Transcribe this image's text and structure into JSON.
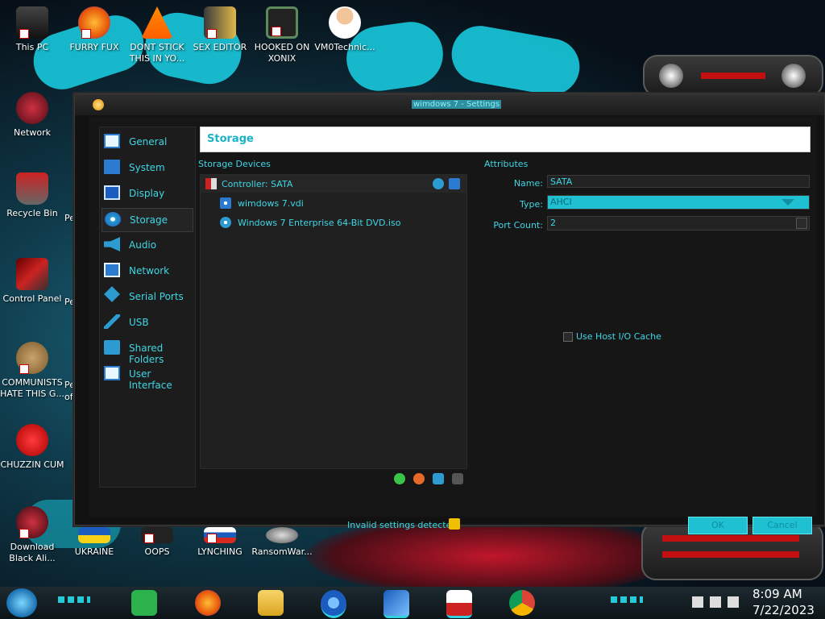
{
  "desktop": {
    "icons": [
      {
        "label": "This PC"
      },
      {
        "label": "FURRY FUX"
      },
      {
        "label": "DONT STICK THIS IN YO..."
      },
      {
        "label": "SEX EDITOR"
      },
      {
        "label": "HOOKED ON XONIX"
      },
      {
        "label": "VM0Technic..."
      },
      {
        "label": "Network"
      },
      {
        "label": "Recycle Bin"
      },
      {
        "label": "Control Panel"
      },
      {
        "label": "COMMUNISTS HATE THIS G..."
      },
      {
        "label": "CHUZZIN CUM"
      },
      {
        "label": "Download Black Ali..."
      },
      {
        "label": "UKRAINE"
      },
      {
        "label": "OOPS"
      },
      {
        "label": "LYNCHING"
      },
      {
        "label": "RansomWar..."
      }
    ],
    "partial_labels": [
      "Pe",
      "Pe",
      "Pe",
      "of"
    ]
  },
  "window": {
    "title": "wimdows 7 - Settings",
    "header": "Storage",
    "sidebar": [
      {
        "label": "General",
        "icon": "monitor-icon"
      },
      {
        "label": "System",
        "icon": "chip-icon"
      },
      {
        "label": "Display",
        "icon": "display-icon"
      },
      {
        "label": "Storage",
        "icon": "disc-icon",
        "active": true
      },
      {
        "label": "Audio",
        "icon": "speaker-icon"
      },
      {
        "label": "Network",
        "icon": "network-icon"
      },
      {
        "label": "Serial Ports",
        "icon": "serial-icon"
      },
      {
        "label": "USB",
        "icon": "usb-icon"
      },
      {
        "label": "Shared Folders",
        "icon": "folder-icon"
      },
      {
        "label": "User Interface",
        "icon": "ui-icon"
      }
    ],
    "storage": {
      "section_label": "Storage Devices",
      "controller": "Controller: SATA",
      "items": [
        {
          "label": "wimdows 7.vdi",
          "icon": "hard-disk-icon"
        },
        {
          "label": "Windows 7 Enterprise 64-Bit DVD.iso",
          "icon": "optical-disc-icon"
        }
      ]
    },
    "attributes": {
      "section_label": "Attributes",
      "name_label": "Name:",
      "name_value": "SATA",
      "type_label": "Type:",
      "type_value": "AHCI",
      "port_label": "Port Count:",
      "port_value": "2",
      "host_io_label": "Use Host I/O Cache"
    },
    "footer": {
      "invalid_text": "Invalid settings detected",
      "ok": "OK",
      "cancel": "Cancel"
    }
  },
  "taskbar": {
    "time": "8:09 AM",
    "date": "7/22/2023",
    "apps": [
      "feedly",
      "firefox",
      "file-explorer",
      "chromium",
      "virtualbox",
      "app",
      "chrome"
    ]
  },
  "colors": {
    "accent": "#3fd6e4",
    "button": "#1ec0d2",
    "window_bg": "#161616"
  }
}
